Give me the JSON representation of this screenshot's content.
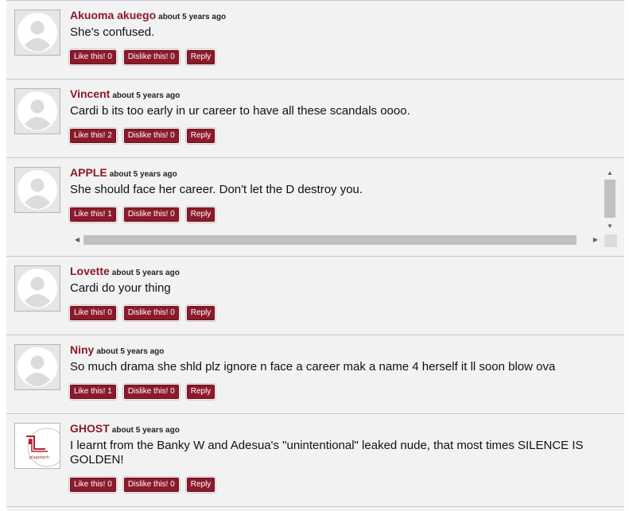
{
  "comments": [
    {
      "author": "Akuoma akuego",
      "time": "about 5 years ago",
      "text": "She's confused.",
      "like": "Like this! 0",
      "dislike": "Dislike this! 0",
      "reply": "Reply"
    },
    {
      "author": "Vincent",
      "time": "about 5 years ago",
      "text": "Cardi b its too early in ur career to have all these scandals oooo.",
      "like": "Like this! 2",
      "dislike": "Dislike this! 0",
      "reply": "Reply"
    },
    {
      "author": "APPLE",
      "time": "about 5 years ago",
      "text": "She should face her career. Don't let the D destroy you.",
      "like": "Like this! 1",
      "dislike": "Dislike this! 0",
      "reply": "Reply"
    },
    {
      "author": "Lovette",
      "time": "about 5 years ago",
      "text": "Cardi do your thing",
      "like": "Like this! 0",
      "dislike": "Dislike this! 0",
      "reply": "Reply"
    },
    {
      "author": "Niny",
      "time": "about 5 years ago",
      "text": "So much drama she shld plz ignore n face a career mak a name 4 herself it ll soon blow ova",
      "like": "Like this! 1",
      "dislike": "Dislike this! 0",
      "reply": "Reply"
    },
    {
      "author": "GHOST",
      "time": "about 5 years ago",
      "text": "I learnt from the Banky W and Adesua's \"unintentional\" leaked nude, that most times SILENCE IS GOLDEN!",
      "like": "Like this! 0",
      "dislike": "Dislike this! 0",
      "reply": "Reply",
      "avatar_text": "plagotech"
    }
  ],
  "colors": {
    "accent": "#8b1a2b",
    "background": "#f2f2f2"
  }
}
